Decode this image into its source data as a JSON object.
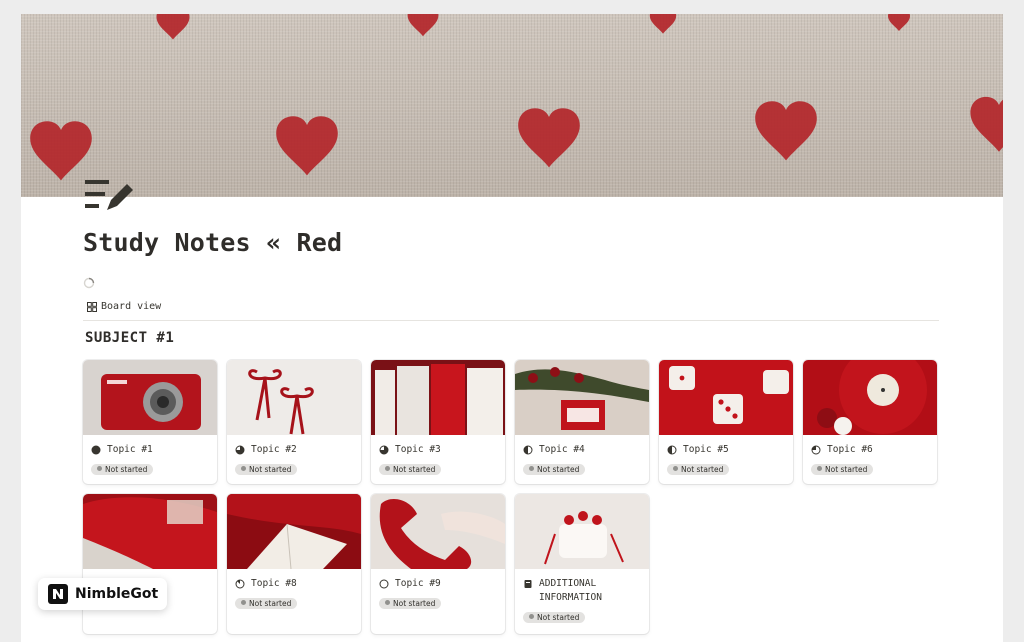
{
  "page": {
    "title": "Study Notes « Red",
    "view_label": "Board view",
    "group_title": "SUBJECT #1"
  },
  "cards": [
    {
      "title": "Topic #1",
      "status": "Not started",
      "icon": "circle-full-icon"
    },
    {
      "title": "Topic #2",
      "status": "Not started",
      "icon": "circle-three-quarter-icon"
    },
    {
      "title": "Topic #3",
      "status": "Not started",
      "icon": "circle-three-quarter-icon"
    },
    {
      "title": "Topic #4",
      "status": "Not started",
      "icon": "circle-half-icon"
    },
    {
      "title": "Topic #5",
      "status": "Not started",
      "icon": "circle-half-icon"
    },
    {
      "title": "Topic #6",
      "status": "Not started",
      "icon": "circle-quarter-icon"
    },
    {
      "title": "",
      "status": "",
      "icon": ""
    },
    {
      "title": "Topic #8",
      "status": "Not started",
      "icon": "circle-eighth-icon"
    },
    {
      "title": "Topic #9",
      "status": "Not started",
      "icon": "circle-empty-icon"
    },
    {
      "title": "ADDITIONAL INFORMATION",
      "status": "Not started",
      "icon": "page-icon"
    }
  ],
  "watermark": {
    "text": "NimbleGot"
  },
  "colors": {
    "accent_red": "#c1272d",
    "cover": "#c6bdb4",
    "badge_bg": "#e3e2e0"
  }
}
